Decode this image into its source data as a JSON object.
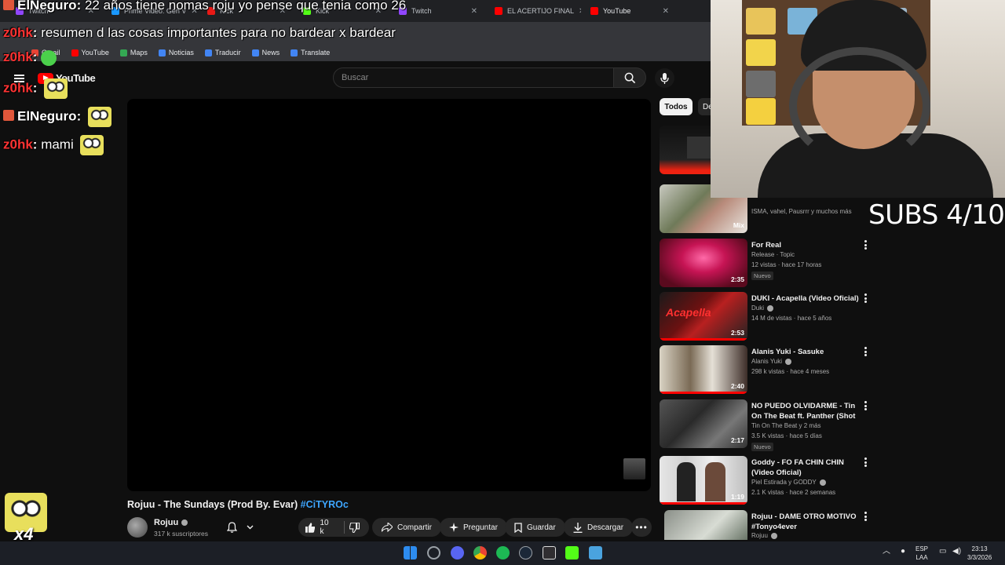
{
  "browser": {
    "tabs": [
      {
        "label": "Twitch",
        "color": "#9146ff"
      },
      {
        "label": "Prime Video: Gen V",
        "color": "#1a98ff"
      },
      {
        "label": "Kick",
        "color": "#e91916"
      },
      {
        "label": "Kick",
        "color": "#53fc18"
      },
      {
        "label": "Twitch",
        "color": "#9146ff"
      },
      {
        "label": "EL ACERTIJO FINAL",
        "color": "#ff0000"
      },
      {
        "label": "YouTube",
        "color": "#ff0000"
      }
    ],
    "bookmarks": [
      {
        "label": "Gmail",
        "color": "#ea4335"
      },
      {
        "label": "YouTube",
        "color": "#ff0000"
      },
      {
        "label": "Maps",
        "color": "#34a853"
      },
      {
        "label": "Noticias",
        "color": "#4285f4"
      },
      {
        "label": "Traducir",
        "color": "#4285f4"
      },
      {
        "label": "News",
        "color": "#4285f4"
      },
      {
        "label": "Translate",
        "color": "#4285f4"
      }
    ]
  },
  "youtube": {
    "logo": "YouTube",
    "search_placeholder": "Buscar",
    "chips": {
      "active": "Todos",
      "next": "De"
    },
    "video": {
      "title": "Rojuu - The Sundays (Prod By. Evar)",
      "hashtag": "#CiTYROc",
      "channel": "Rojuu",
      "subscribers": "317 k suscriptores",
      "likes": "10 k",
      "share": "Compartir",
      "ask": "Preguntar",
      "save": "Guardar",
      "download": "Descargar"
    },
    "recommendations": [
      {
        "title": "",
        "channel": "ISMA, vahel, Pausrrr y muchos más",
        "stats": "",
        "duration": "Mix",
        "badge": ""
      },
      {
        "title": "For Real",
        "channel": "Release · Topic",
        "stats": "12 vistas · hace 17 horas",
        "duration": "2:35",
        "badge": "Nuevo"
      },
      {
        "title": "DUKI - Acapella (Video Oficial)",
        "channel": "Duki",
        "stats": "14 M de vistas · hace 5 años",
        "duration": "2:53",
        "badge": ""
      },
      {
        "title": "Alanis Yuki - Sasuke",
        "channel": "Alanis Yuki",
        "stats": "298 k vistas · hace 4 meses",
        "duration": "2:40",
        "badge": ""
      },
      {
        "title": "NO PUEDO OLVIDARME - Tin On The Beat ft. Panther (Shot By. ...",
        "channel": "Tin On The Beat y 2 más",
        "stats": "3.5 K vistas · hace 5 días",
        "duration": "2:17",
        "badge": "Nuevo"
      },
      {
        "title": "Goddy - FO FA CHIN CHIN (Video Oficial)",
        "channel": "Piel Estirada y GODDY",
        "stats": "2.1 K vistas · hace 2 semanas",
        "duration": "1:19",
        "badge": ""
      },
      {
        "title": "Rojuu - DAME OTRO MOTIVO #Tonyo4ever",
        "channel": "Rojuu",
        "stats": "",
        "duration": "",
        "badge": ""
      }
    ]
  },
  "stream_overlay": {
    "chat": [
      {
        "user": "ElNeguro",
        "message": "22 años tiene nomas roju yo pense que tenia como 26",
        "color": "#ffffff"
      },
      {
        "user": "z0hk",
        "message": "resumen d las cosas importantes para no bardear x bardear",
        "color": "#ff3333"
      },
      {
        "user": "z0hk",
        "message": "",
        "color": "#ff3333"
      },
      {
        "user": "z0hk",
        "message": "",
        "color": "#ff3333"
      },
      {
        "user": "ElNeguro",
        "message": "",
        "color": "#ffffff"
      },
      {
        "user": "z0hk",
        "message": "mami",
        "color": "#ff3333"
      }
    ],
    "subs_goal": "SUBS 4/10",
    "emote_multiplier": "x4"
  },
  "taskbar": {
    "lang_top": "ESP",
    "lang_bottom": "LAA",
    "time": "23:13",
    "date": "3/3/2026",
    "apps": [
      {
        "name": "windows",
        "color": "#2d8cf0"
      },
      {
        "name": "settings",
        "color": "#9aa0a6"
      },
      {
        "name": "discord",
        "color": "#5865f2"
      },
      {
        "name": "chrome",
        "color": "#ea4335"
      },
      {
        "name": "spotify",
        "color": "#1db954"
      },
      {
        "name": "steam",
        "color": "#1b2838"
      },
      {
        "name": "obs",
        "color": "#302e31"
      },
      {
        "name": "kick",
        "color": "#53fc18"
      },
      {
        "name": "notepad",
        "color": "#4aa3df"
      }
    ]
  }
}
